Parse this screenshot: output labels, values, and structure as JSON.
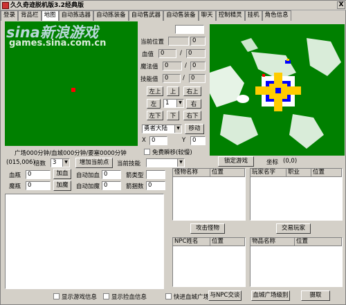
{
  "window": {
    "title": "久久奇迹脱机版3.2经典版",
    "close": "X"
  },
  "tabs": [
    "登录",
    "背品栏",
    "地图",
    "自动拣选器",
    "自动拣装备",
    "自动售武器",
    "自动售装备",
    "聊天",
    "控制精灵",
    "挂机",
    "角色信息"
  ],
  "watermark": {
    "logo": "sina新浪游戏",
    "url": "games.sina.com.cn"
  },
  "status": {
    "current_pos_label": "当前位置",
    "hp_label": "血值",
    "mp_label": "魔法值",
    "sp_label": "技能值",
    "slash": "/",
    "zero": "0"
  },
  "movement": {
    "up_left": "左上",
    "up": "上",
    "up_right": "右上",
    "left": "左",
    "speed": "1",
    "right": "右",
    "down_left": "左下",
    "down": "下",
    "down_right": "右下",
    "move_button": "移动",
    "map": "勇者大陆",
    "x_label": "X",
    "x_value": "0",
    "y_label": "Y",
    "y_value": "0",
    "free_teleport": "免费瞬移(较慢)"
  },
  "info_line": "广场000分钟/血城000分钟/要塞0000分钟",
  "lock_game": "锁定游戏",
  "coords": {
    "label": "坐标",
    "value": "(0,0)"
  },
  "row1": {
    "pos": "(015,006)",
    "multiplier_label": "倍数",
    "multiplier": "3",
    "add_current_point": "增加当前点",
    "current_skill": "当前技能"
  },
  "row2": {
    "hp_bottle": "血瓶",
    "hp_bottle_val": "0",
    "add_hp": "加血",
    "auto_add_hp": "自动加血",
    "auto_add_hp_val": "0",
    "arrow_type": "箭类型"
  },
  "row3": {
    "mp_bottle": "魔瓶",
    "mp_bottle_val": "0",
    "add_mp": "加魔",
    "auto_add_mp": "自动加魔",
    "auto_add_mp_val": "0",
    "arrow_count": "箭捆数",
    "arrow_count_val": "0"
  },
  "monsters": {
    "col1": "怪物名称",
    "col2": "位置"
  },
  "players": {
    "col1": "玩家名字",
    "col2": "职业",
    "col3": "位置"
  },
  "attack_monster": "攻击怪物",
  "trade_player": "交易玩家",
  "npc": {
    "col1": "NPC姓名",
    "col2": "位置"
  },
  "items": {
    "col1": "物品名称",
    "col2": "位置"
  },
  "bottom": {
    "show_game_info": "显示游戏信息",
    "show_pickup_info": "显示捡血信息",
    "quick_enter": "快进血城广场",
    "npc_talk": "与NPC交谈",
    "blood_level": "血城广场级别",
    "grab": "摄取"
  },
  "colors": {
    "field_green": "#008000",
    "map_green": "#008000",
    "player_red": "#ff0000"
  }
}
